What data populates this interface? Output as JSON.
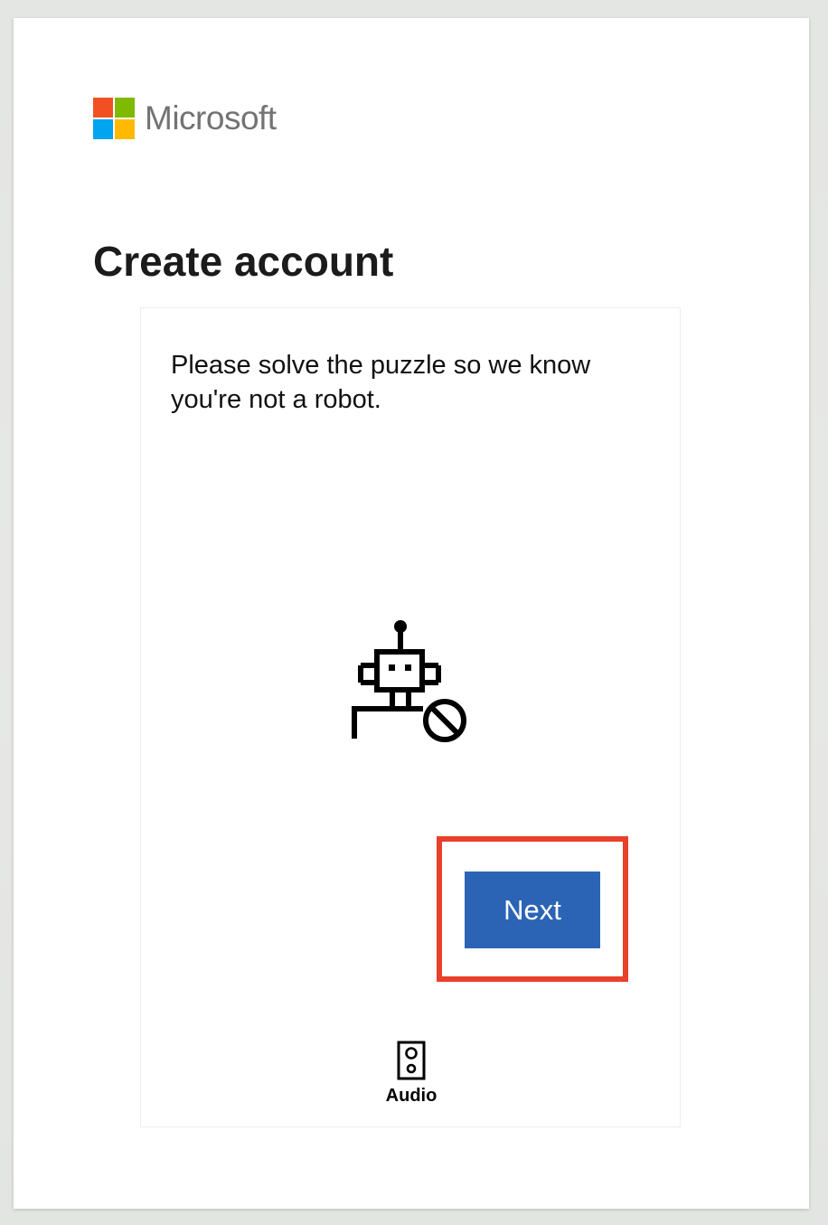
{
  "brand": {
    "name": "Microsoft",
    "logo_colors": [
      "#f25022",
      "#7fba00",
      "#00a4ef",
      "#ffb900"
    ],
    "logo_icon": "microsoft-logo-icon"
  },
  "page": {
    "title": "Create account"
  },
  "puzzle": {
    "instructions": "Please solve the puzzle so we know you're not a robot.",
    "illustration_icon": "robot-blocked-icon",
    "next_label": "Next",
    "audio_label": "Audio",
    "audio_icon": "speaker-icon"
  },
  "colors": {
    "primary_button": "#2b64b5",
    "highlight": "#e8402a"
  }
}
